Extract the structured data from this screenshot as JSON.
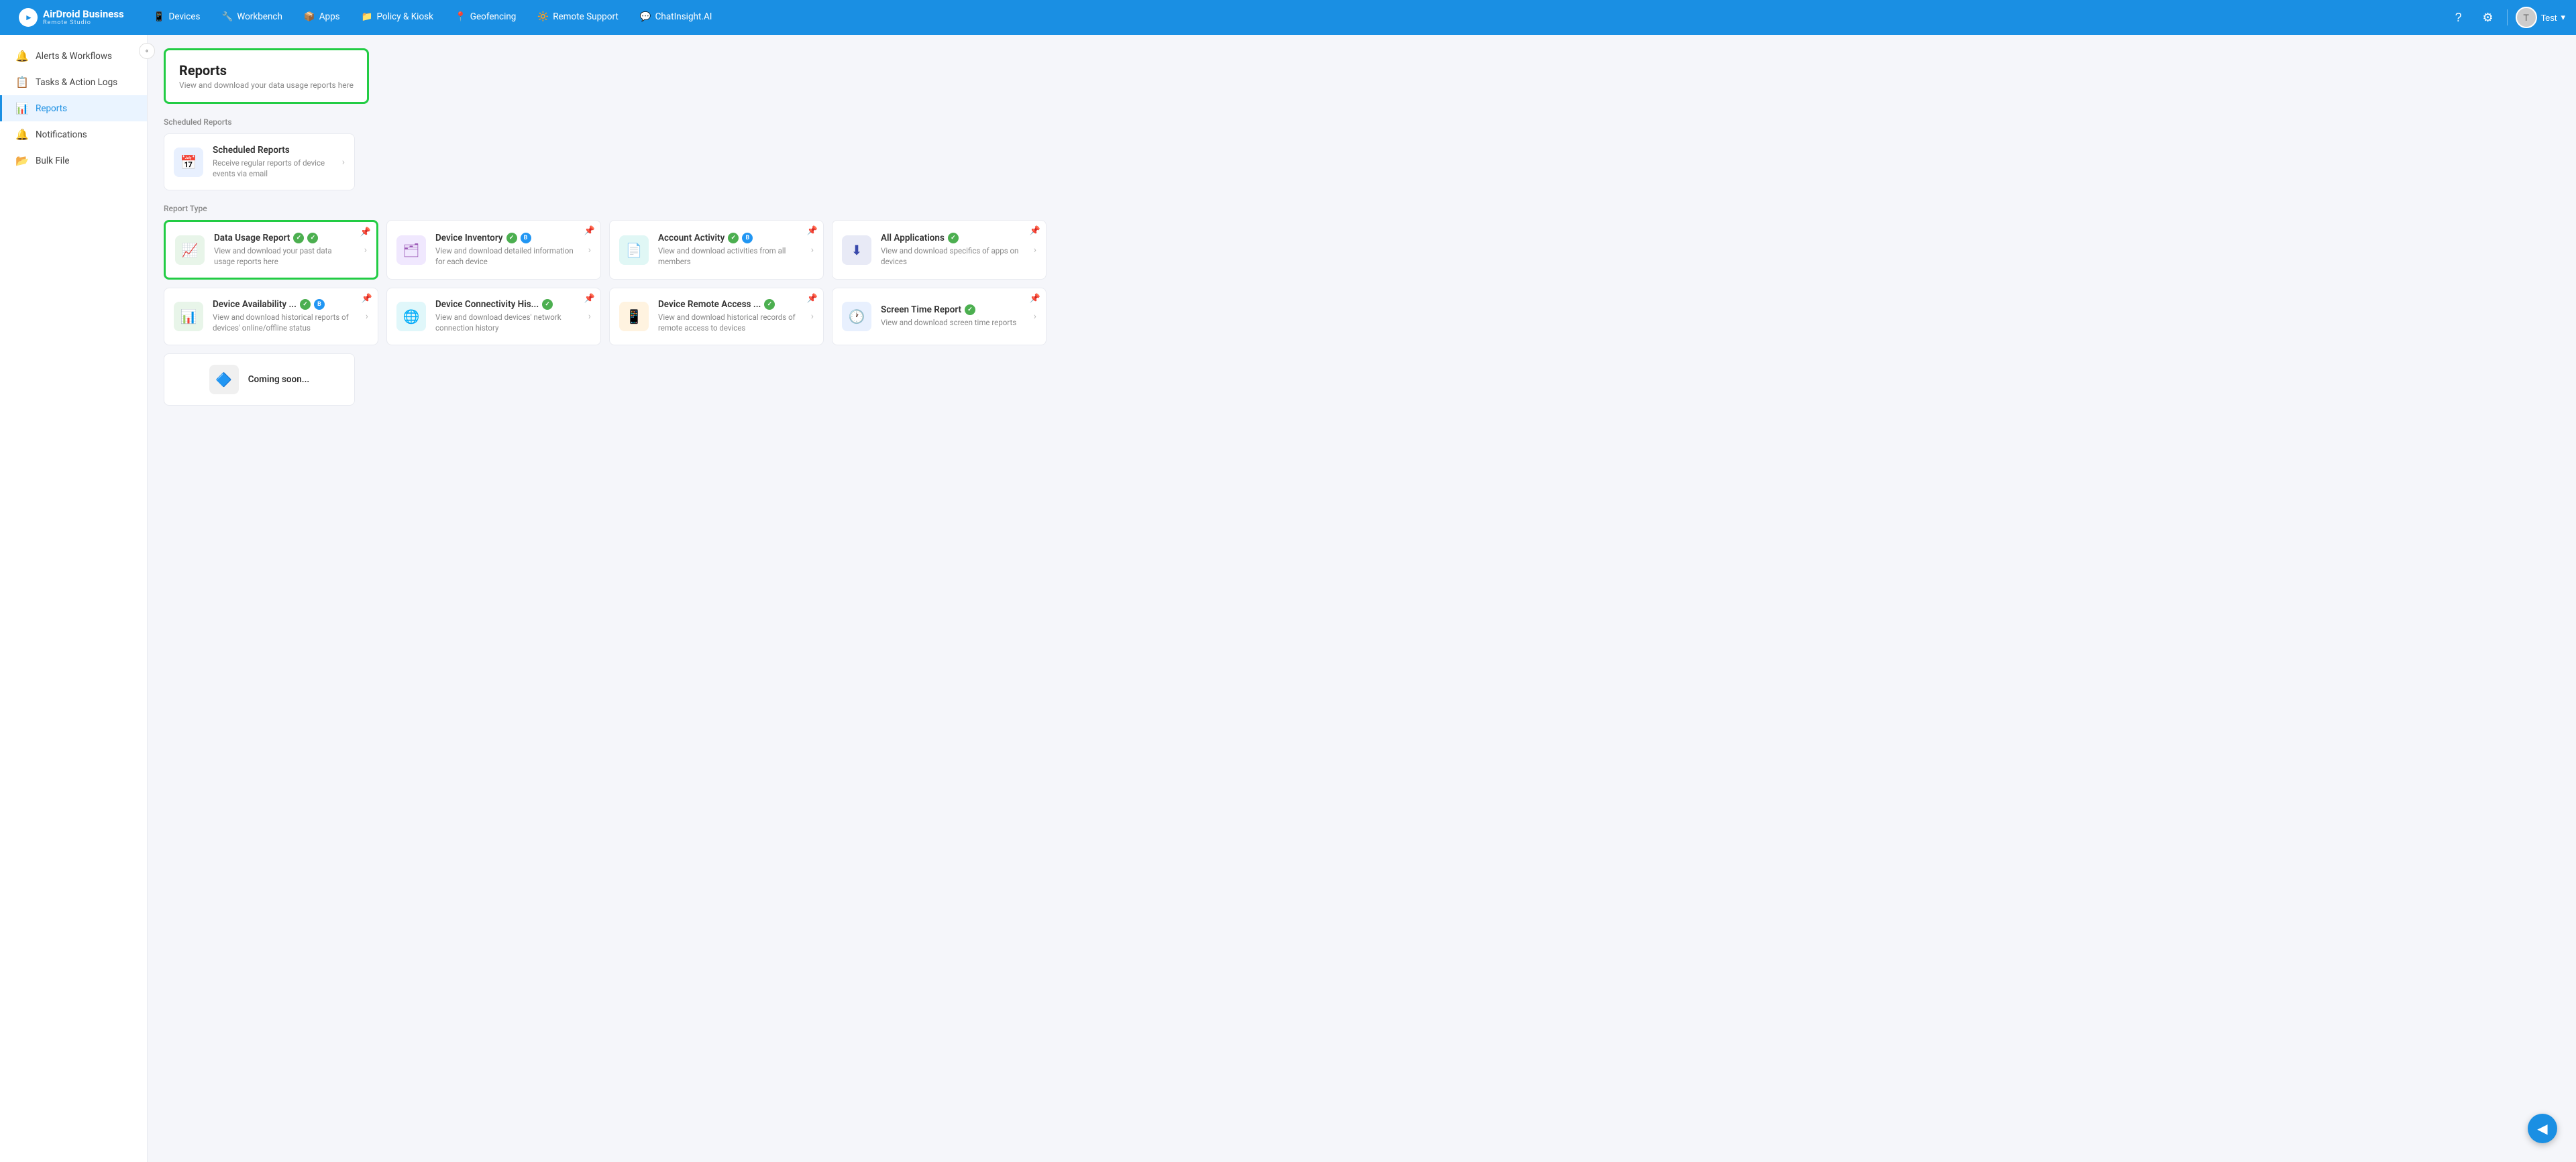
{
  "brand": {
    "name": "AirDroid Business",
    "sub": "Remote Studio"
  },
  "nav": {
    "items": [
      {
        "id": "devices",
        "label": "Devices",
        "icon": "📱"
      },
      {
        "id": "workbench",
        "label": "Workbench",
        "icon": "🔧"
      },
      {
        "id": "apps",
        "label": "Apps",
        "icon": "📦"
      },
      {
        "id": "policy",
        "label": "Policy & Kiosk",
        "icon": "📁"
      },
      {
        "id": "geofencing",
        "label": "Geofencing",
        "icon": "📍"
      },
      {
        "id": "remote",
        "label": "Remote Support",
        "icon": "🔆"
      },
      {
        "id": "chat",
        "label": "ChatInsight.AI",
        "icon": "💬"
      }
    ],
    "user": "Test"
  },
  "sidebar": {
    "items": [
      {
        "id": "alerts",
        "label": "Alerts & Workflows",
        "icon": "🔔"
      },
      {
        "id": "tasks",
        "label": "Tasks & Action Logs",
        "icon": "📋"
      },
      {
        "id": "reports",
        "label": "Reports",
        "icon": "📊",
        "active": true
      },
      {
        "id": "notifications",
        "label": "Notifications",
        "icon": "🔔"
      },
      {
        "id": "bulkfile",
        "label": "Bulk File",
        "icon": "📂"
      }
    ],
    "collapse_icon": "«"
  },
  "page": {
    "title": "Reports",
    "subtitle": "View and download your data usage reports here"
  },
  "scheduled_section": {
    "label": "Scheduled Reports",
    "card": {
      "title": "Scheduled Reports",
      "desc": "Receive regular reports of device events via email",
      "icon": "📅",
      "icon_style": "blue"
    }
  },
  "report_type_section": {
    "label": "Report Type",
    "cards": [
      {
        "id": "data-usage",
        "title": "Data Usage Report",
        "desc": "View and download your past data usage reports here",
        "icon": "📈",
        "icon_style": "green",
        "selected": true,
        "badges": [
          "green",
          "green"
        ],
        "pin": true
      },
      {
        "id": "device-inventory",
        "title": "Device Inventory",
        "desc": "View and download detailed information for each device",
        "icon": "🗂",
        "icon_style": "purple",
        "selected": false,
        "badges": [
          "green",
          "blue"
        ],
        "pin": true
      },
      {
        "id": "account-activity",
        "title": "Account Activity",
        "desc": "View and download activities from all members",
        "icon": "📄",
        "icon_style": "teal",
        "selected": false,
        "badges": [
          "green",
          "blue"
        ],
        "pin": true
      },
      {
        "id": "all-applications",
        "title": "All Applications",
        "desc": "View and download specifics of apps on devices",
        "icon": "⬇",
        "icon_style": "indigo",
        "selected": false,
        "badges": [
          "green"
        ],
        "pin": true
      },
      {
        "id": "device-availability",
        "title": "Device Availability ...",
        "desc": "View and download historical reports of devices' online/offline status",
        "icon": "📊",
        "icon_style": "green",
        "selected": false,
        "badges": [
          "green",
          "blue"
        ],
        "pin": true
      },
      {
        "id": "device-connectivity",
        "title": "Device Connectivity His...",
        "desc": "View and download devices' network connection history",
        "icon": "🌐",
        "icon_style": "cyan",
        "selected": false,
        "badges": [
          "green"
        ],
        "pin": true
      },
      {
        "id": "device-remote-access",
        "title": "Device Remote Access ...",
        "desc": "View and download historical records of remote access to devices",
        "icon": "📱",
        "icon_style": "orange",
        "selected": false,
        "badges": [
          "green"
        ],
        "pin": true
      },
      {
        "id": "screen-time",
        "title": "Screen Time Report",
        "desc": "View and download screen time reports",
        "icon": "🕐",
        "icon_style": "blue",
        "selected": false,
        "badges": [
          "green"
        ],
        "pin": true
      },
      {
        "id": "coming-soon",
        "title": "Coming soon...",
        "desc": "",
        "icon": "🔷",
        "icon_style": "gray",
        "selected": false,
        "badges": [],
        "pin": false
      }
    ]
  },
  "fab": {
    "icon": "◀"
  }
}
